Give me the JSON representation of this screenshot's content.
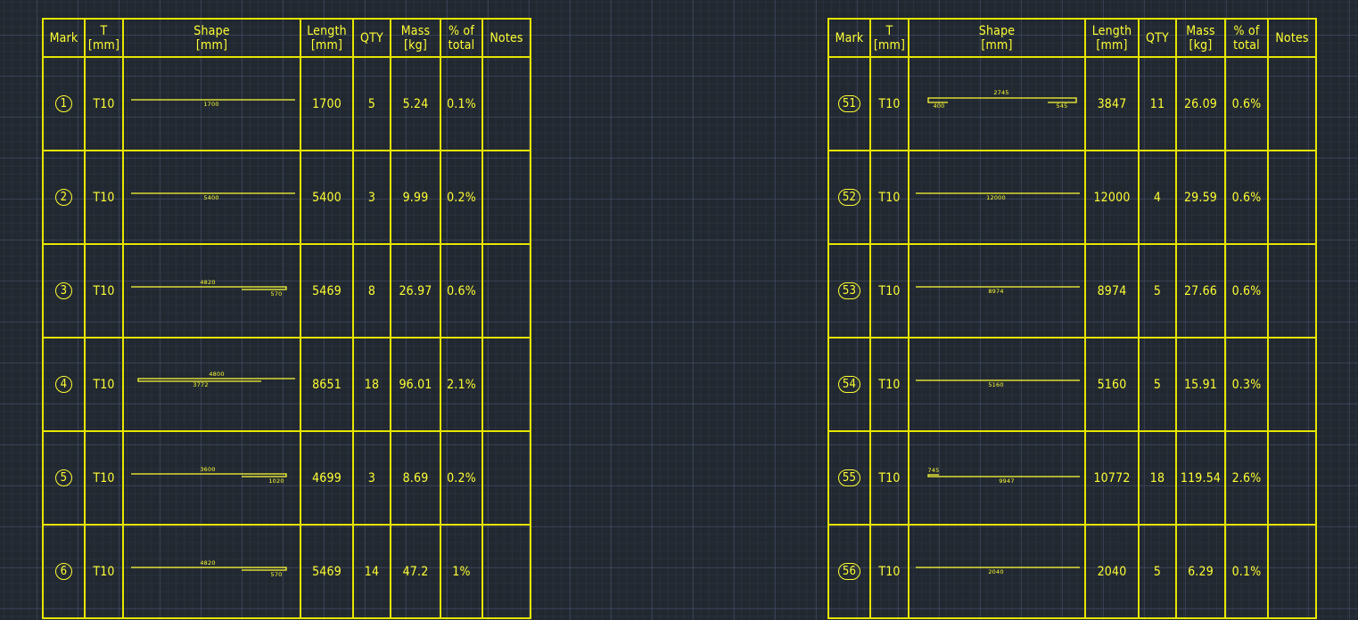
{
  "headers": {
    "mark": "Mark",
    "t_line1": "T",
    "t_line2": "[mm]",
    "shape_line1": "Shape",
    "shape_line2": "[mm]",
    "length_line1": "Length",
    "length_line2": "[mm]",
    "qty": "QTY",
    "mass_line1": "Mass",
    "mass_line2": "[kg]",
    "pct_line1": "% of",
    "pct_line2": "total",
    "notes": "Notes"
  },
  "colors": {
    "background": "#212830",
    "lines": "#e6e600",
    "text": "#ffff33"
  },
  "left_table": {
    "rows": [
      {
        "mark": "1",
        "t": "T10",
        "shape": {
          "type": "straight",
          "labels": [
            "1700"
          ]
        },
        "length": "1700",
        "qty": "5",
        "mass": "5.24",
        "pct": "0.1%",
        "notes": ""
      },
      {
        "mark": "2",
        "t": "T10",
        "shape": {
          "type": "straight",
          "labels": [
            "5400"
          ]
        },
        "length": "5400",
        "qty": "3",
        "mass": "9.99",
        "pct": "0.2%",
        "notes": ""
      },
      {
        "mark": "3",
        "t": "T10",
        "shape": {
          "type": "hook-right",
          "labels": [
            "4820",
            "570"
          ]
        },
        "length": "5469",
        "qty": "8",
        "mass": "26.97",
        "pct": "0.6%",
        "notes": ""
      },
      {
        "mark": "4",
        "t": "T10",
        "shape": {
          "type": "hook-left-long",
          "labels": [
            "4800",
            "3772"
          ]
        },
        "length": "8651",
        "qty": "18",
        "mass": "96.01",
        "pct": "2.1%",
        "notes": ""
      },
      {
        "mark": "5",
        "t": "T10",
        "shape": {
          "type": "hook-right",
          "labels": [
            "3600",
            "1020"
          ]
        },
        "length": "4699",
        "qty": "3",
        "mass": "8.69",
        "pct": "0.2%",
        "notes": ""
      },
      {
        "mark": "6",
        "t": "T10",
        "shape": {
          "type": "hook-right",
          "labels": [
            "4820",
            "570"
          ]
        },
        "length": "5469",
        "qty": "14",
        "mass": "47.2",
        "pct": "1%",
        "notes": ""
      }
    ]
  },
  "right_table": {
    "rows": [
      {
        "mark": "51",
        "t": "T10",
        "shape": {
          "type": "u-bar",
          "labels": [
            "2745",
            "400",
            "545"
          ]
        },
        "length": "3847",
        "qty": "11",
        "mass": "26.09",
        "pct": "0.6%",
        "notes": ""
      },
      {
        "mark": "52",
        "t": "T10",
        "shape": {
          "type": "straight",
          "labels": [
            "12000"
          ]
        },
        "length": "12000",
        "qty": "4",
        "mass": "29.59",
        "pct": "0.6%",
        "notes": ""
      },
      {
        "mark": "53",
        "t": "T10",
        "shape": {
          "type": "straight",
          "labels": [
            "8974"
          ]
        },
        "length": "8974",
        "qty": "5",
        "mass": "27.66",
        "pct": "0.6%",
        "notes": ""
      },
      {
        "mark": "54",
        "t": "T10",
        "shape": {
          "type": "straight",
          "labels": [
            "5160"
          ]
        },
        "length": "5160",
        "qty": "5",
        "mass": "15.91",
        "pct": "0.3%",
        "notes": ""
      },
      {
        "mark": "55",
        "t": "T10",
        "shape": {
          "type": "hook-left-short",
          "labels": [
            "745",
            "9947"
          ]
        },
        "length": "10772",
        "qty": "18",
        "mass": "119.54",
        "pct": "2.6%",
        "notes": ""
      },
      {
        "mark": "56",
        "t": "T10",
        "shape": {
          "type": "straight",
          "labels": [
            "2040"
          ]
        },
        "length": "2040",
        "qty": "5",
        "mass": "6.29",
        "pct": "0.1%",
        "notes": ""
      }
    ]
  }
}
